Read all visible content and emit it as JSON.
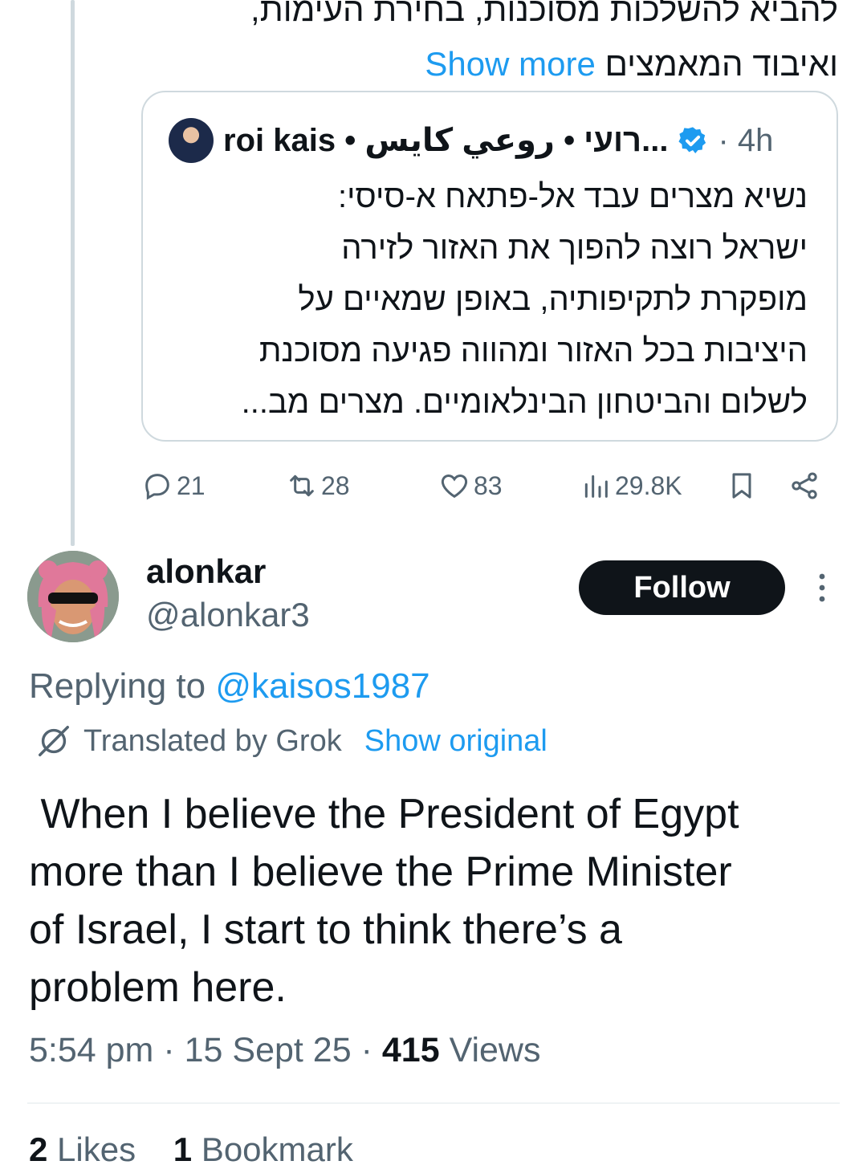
{
  "previous_tweet": {
    "partial_line": "להביא להשלכות מסוכנות, בחירת העימות,",
    "last_line": "ואיבוד המאמצים",
    "show_more": "Show more"
  },
  "quoted_tweet": {
    "author": "roi kais • רועי • روعي كايس...",
    "time_sep": "·",
    "time": "4h",
    "body_lines": [
      "נשיא מצרים עבד אל-פתאח א-סיסי:",
      "ישראל רוצה להפוך את האזור לזירה",
      "מופקרת לתקיפותיה, באופן שמאיים על",
      "היציבות בכל האזור ומהווה פגיעה מסוכנת",
      "לשלום והביטחון הבינלאומיים. מצרים מב..."
    ]
  },
  "actions": {
    "replies": "21",
    "reposts": "28",
    "likes": "83",
    "views": "29.8K"
  },
  "author": {
    "name": "alonkar",
    "handle": "@alonkar3",
    "follow_label": "Follow"
  },
  "replying": {
    "prefix": "Replying to",
    "mention": "@kaisos1987"
  },
  "translation": {
    "label": "Translated by Grok",
    "show_original": "Show original"
  },
  "tweet": {
    "text": " When I believe the President of Egypt\nmore than I believe the Prime Minister\nof Israel, I start to think there’s a\nproblem here.",
    "time": "5:54 pm",
    "sep": "·",
    "date": "15 Sept 25",
    "views_count": "415",
    "views_label": "Views"
  },
  "engagement": {
    "likes_count": "2",
    "likes_label": "Likes",
    "bookmarks_count": "1",
    "bookmarks_label": "Bookmark"
  },
  "colors": {
    "accent": "#1d9bf0",
    "text": "#0f1419",
    "muted": "#536471"
  }
}
